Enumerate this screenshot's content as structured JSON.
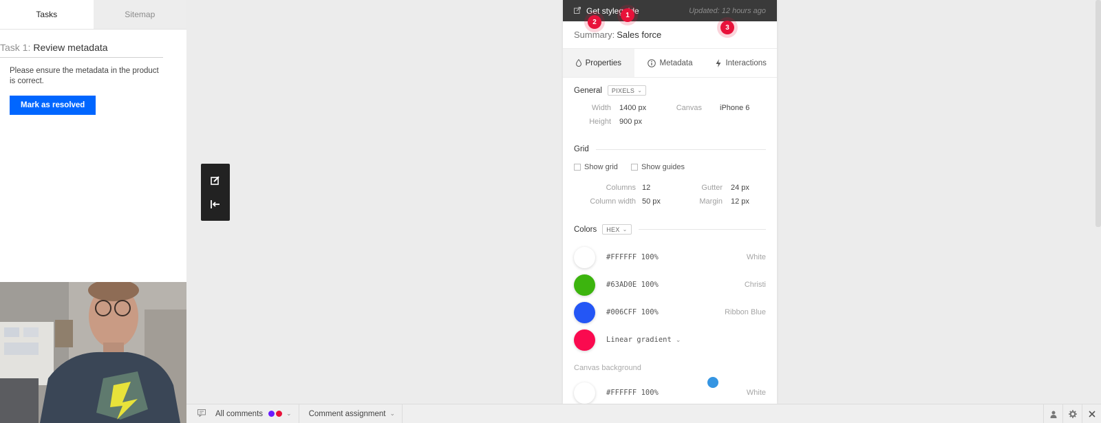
{
  "left_panel": {
    "tabs": [
      {
        "label": "Tasks",
        "active": true
      },
      {
        "label": "Sitemap",
        "active": false
      }
    ],
    "task": {
      "number": "Task 1:",
      "title": "Review metadata",
      "description": "Please ensure the metadata in the product is correct.",
      "resolve_button": "Mark as resolved"
    }
  },
  "canvas_tools": {
    "icons": [
      "edit-icon",
      "exit-icon"
    ]
  },
  "inspector": {
    "header": {
      "styleguide_label": "Get styleguide",
      "updated": "Updated: 12 hours ago"
    },
    "summary": {
      "label": "Summary:",
      "value": "Sales force"
    },
    "tabs": [
      {
        "label": "Properties",
        "icon": "drop-icon",
        "active": true
      },
      {
        "label": "Metadata",
        "icon": "info-icon",
        "active": false
      },
      {
        "label": "Interactions",
        "icon": "bolt-icon",
        "active": false
      }
    ],
    "general": {
      "title": "General",
      "unit": "PIXELS",
      "width_label": "Width",
      "width_value": "1400 px",
      "height_label": "Height",
      "height_value": "900 px",
      "canvas_label": "Canvas",
      "canvas_value": "iPhone 6"
    },
    "grid": {
      "title": "Grid",
      "show_grid": "Show grid",
      "show_guides": "Show guides",
      "columns_label": "Columns",
      "columns_value": "12",
      "column_width_label": "Column width",
      "column_width_value": "50 px",
      "gutter_label": "Gutter",
      "gutter_value": "24 px",
      "margin_label": "Margin",
      "margin_value": "12 px"
    },
    "colors": {
      "title": "Colors",
      "format": "HEX",
      "items": [
        {
          "code": "#FFFFFF 100%",
          "name": "White",
          "color": "#FFFFFF"
        },
        {
          "code": "#63AD0E 100%",
          "name": "Christi",
          "color": "#3cb40e"
        },
        {
          "code": "#006CFF 100%",
          "name": "Ribbon Blue",
          "color": "#2456f5"
        },
        {
          "code": "Linear gradient",
          "name": "",
          "color": "#fa0a4f"
        }
      ],
      "canvas_background_label": "Canvas background",
      "canvas_background": {
        "code": "#FFFFFF 100%",
        "name": "White",
        "color": "#FFFFFF"
      }
    },
    "badges": [
      "1",
      "2",
      "3"
    ]
  },
  "bottom_bar": {
    "all_comments": "All comments",
    "comment_dots": [
      "#6a1cff",
      "#e8123a"
    ],
    "comment_assignment": "Comment assignment",
    "right_icons": [
      "user-icon",
      "gear-icon",
      "close-icon"
    ]
  }
}
